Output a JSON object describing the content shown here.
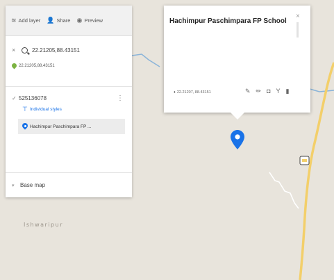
{
  "toolbar": {
    "add_layer": "Add layer",
    "share": "Share",
    "preview": "Preview"
  },
  "search": {
    "close_icon": "close-icon",
    "value": "22.21205,88.43151"
  },
  "result": {
    "coords": "22.21205,88.43151"
  },
  "layer": {
    "name": "525136078",
    "styles_label": "Individual styles",
    "item_label": "Hachimpur Paschimpara FP ..."
  },
  "basemap": {
    "label": "Base map"
  },
  "popup": {
    "title": "Hachimpur Paschimpara FP School",
    "coords": "22.21207, 88.43151"
  },
  "map": {
    "place_label": "Ishwaripur"
  },
  "colors": {
    "accent_blue": "#1a73e8",
    "pin_green": "#7cb342",
    "road_yellow": "#f3cf6a",
    "river_blue": "#8ab4d9"
  }
}
